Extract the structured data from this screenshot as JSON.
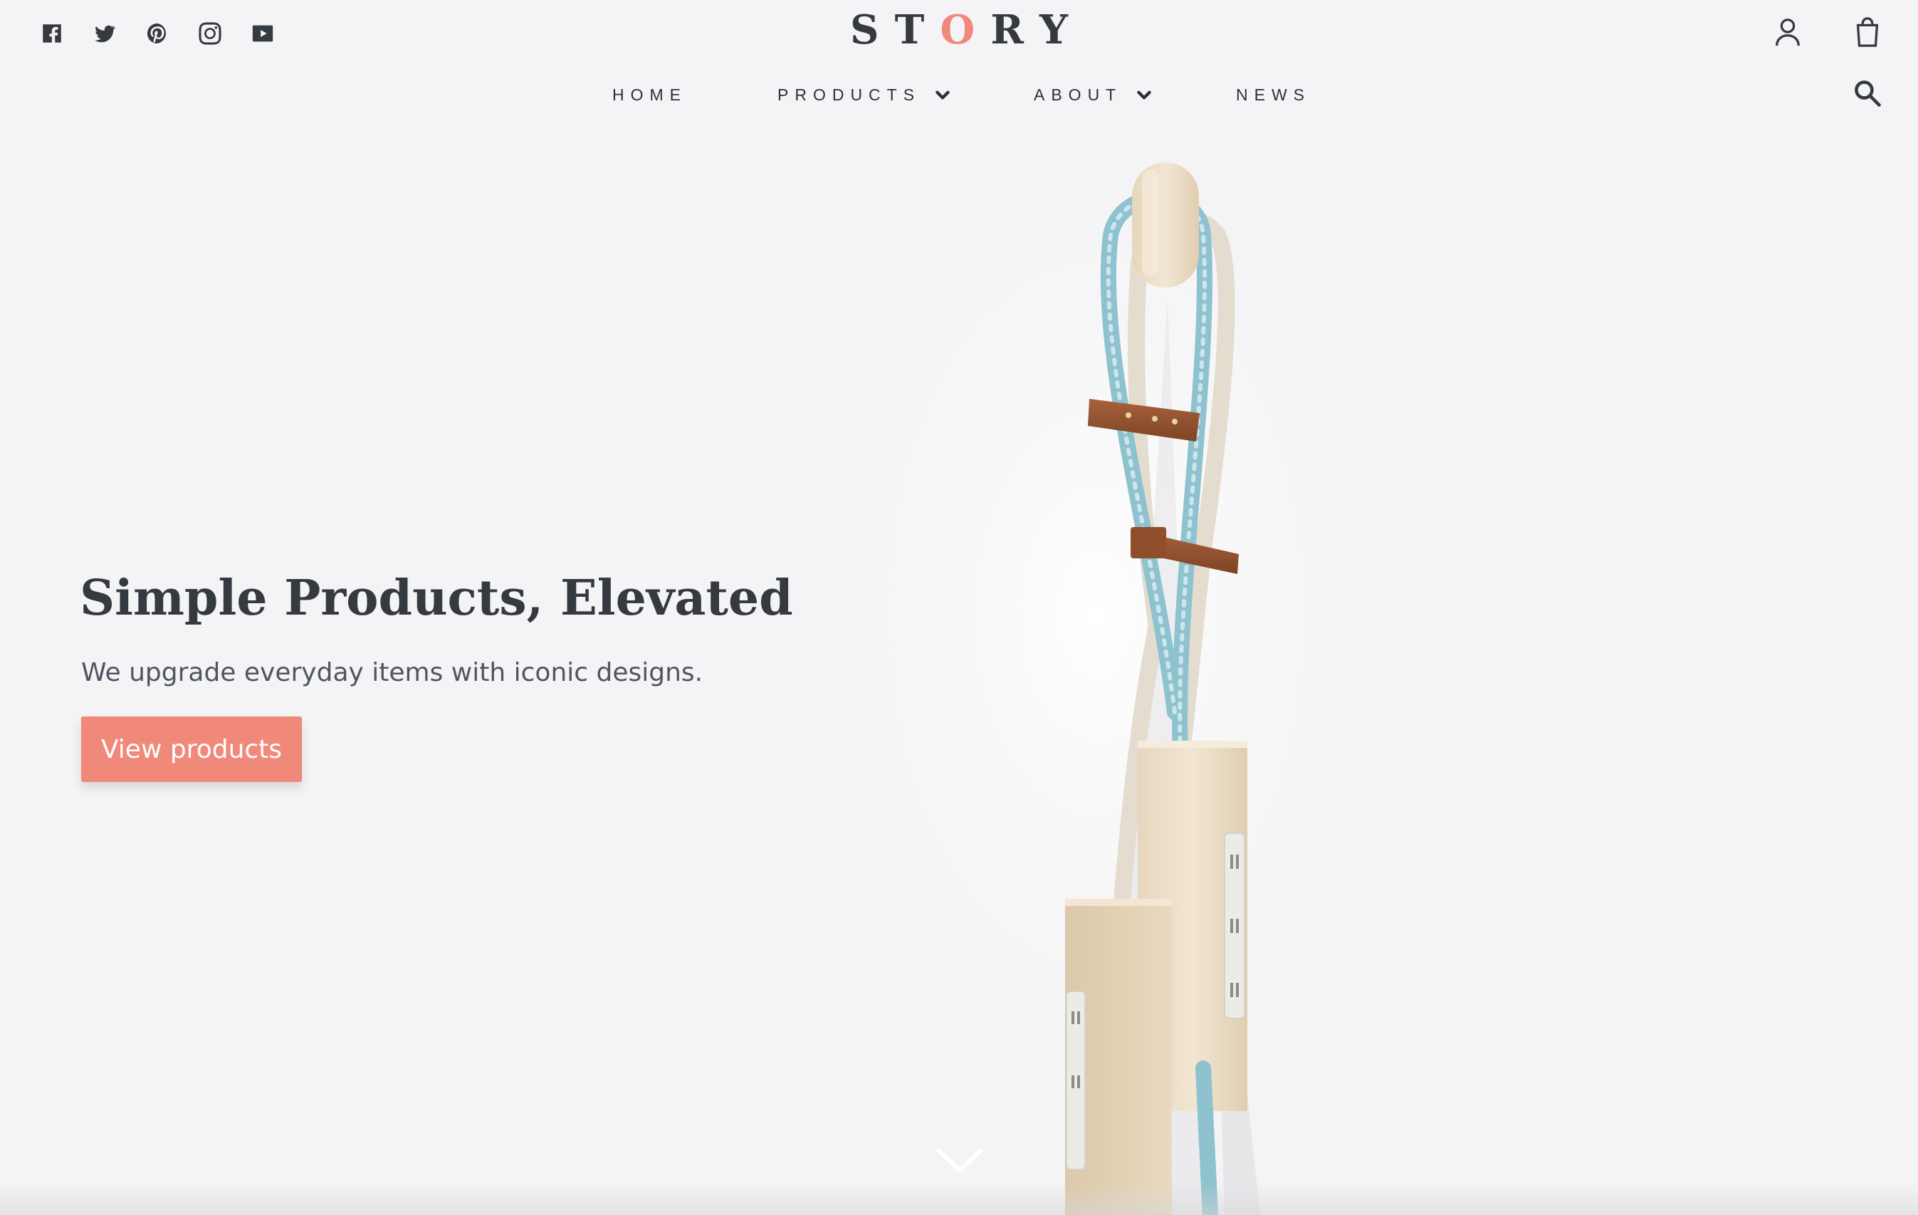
{
  "header": {
    "social": [
      {
        "name": "facebook",
        "icon": "facebook-icon"
      },
      {
        "name": "twitter",
        "icon": "twitter-icon"
      },
      {
        "name": "pinterest",
        "icon": "pinterest-icon"
      },
      {
        "name": "instagram",
        "icon": "instagram-icon"
      },
      {
        "name": "youtube",
        "icon": "youtube-icon"
      }
    ],
    "logo": {
      "letters": [
        "S",
        "T",
        "O",
        "R",
        "Y"
      ],
      "accent_letter": "O"
    },
    "icons": {
      "account": "user-icon",
      "cart": "shopping-bag-icon",
      "search": "search-icon"
    }
  },
  "nav": [
    {
      "label": "HOME",
      "has_dropdown": false
    },
    {
      "label": "PRODUCTS",
      "has_dropdown": true
    },
    {
      "label": "ABOUT",
      "has_dropdown": true
    },
    {
      "label": "NEWS",
      "has_dropdown": false
    }
  ],
  "hero": {
    "title": "Simple Products, Elevated",
    "subtitle": "We upgrade everyday items with iconic designs.",
    "cta_label": "View products",
    "scroll_icon": "chevron-down-icon"
  },
  "colors": {
    "background": "#f4f4f6",
    "text": "#353a40",
    "accent": "#f0897a",
    "cta_text": "#ffffff"
  }
}
